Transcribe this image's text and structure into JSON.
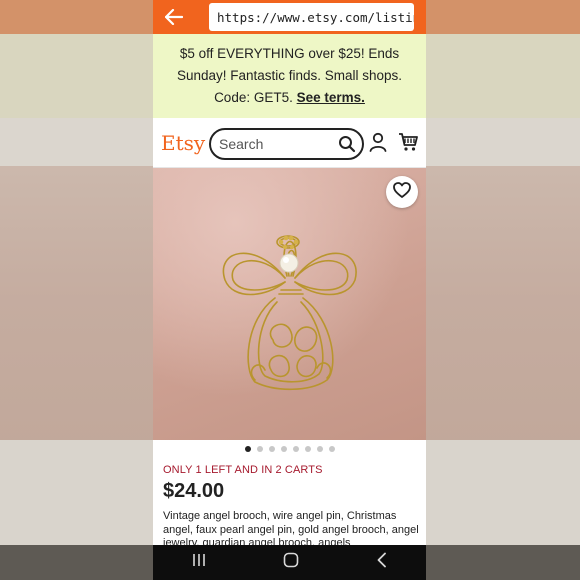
{
  "browser": {
    "url": "https://www.etsy.com/listing/"
  },
  "promo": {
    "text": "$5 off EVERYTHING over $25! Ends Sunday! Fantastic finds. Small shops. Code: GET5.",
    "link": "See terms."
  },
  "header": {
    "logo": "Etsy",
    "search_placeholder": "Search"
  },
  "listing": {
    "image_count": 8,
    "active_image": 1,
    "stock_note": "ONLY 1 LEFT AND IN 2 CARTS",
    "price": "$24.00",
    "description": "Vintage angel brooch, wire angel pin, Christmas angel, faux pearl angel pin, gold angel brooch, angel jewelry, guardian angel brooch, angels"
  },
  "colors": {
    "brand_orange": "#f1641e",
    "promo_bg": "#eef7c6",
    "stock_red": "#a61a2e"
  },
  "icons": [
    "back-arrow-icon",
    "search-icon",
    "account-icon",
    "cart-icon",
    "heart-icon",
    "recents-icon",
    "home-icon",
    "back-icon"
  ]
}
